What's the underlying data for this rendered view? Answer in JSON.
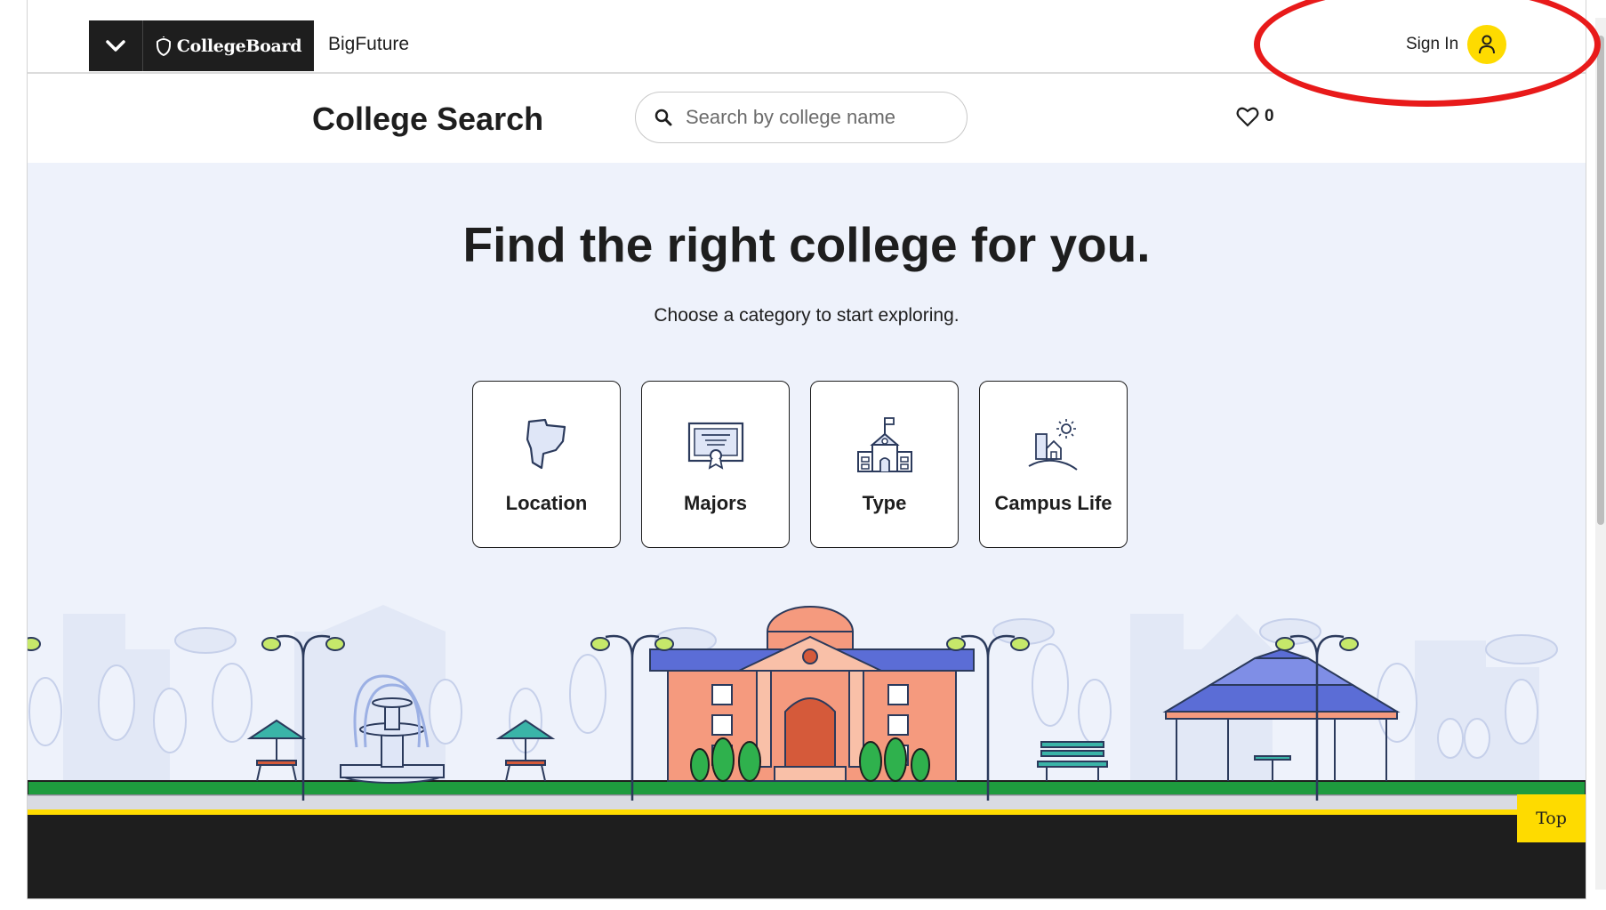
{
  "header": {
    "brand_name": "CollegeBoard",
    "sub_brand": "BigFuture",
    "sign_in_label": "Sign In"
  },
  "local_header": {
    "title": "College Search",
    "search_placeholder": "Search by college name",
    "saved_count": "0"
  },
  "hero": {
    "title": "Find the right college for you.",
    "subtitle": "Choose a category to start exploring."
  },
  "categories": [
    {
      "label": "Location",
      "icon": "map-state-icon"
    },
    {
      "label": "Majors",
      "icon": "diploma-icon"
    },
    {
      "label": "Type",
      "icon": "school-building-icon"
    },
    {
      "label": "Campus Life",
      "icon": "campus-life-icon"
    }
  ],
  "top_button": "Top",
  "colors": {
    "accent_yellow": "#fedb00",
    "dark": "#1e1e1e",
    "hero_bg": "#eef2fb",
    "annotation_red": "#e81a1a"
  }
}
